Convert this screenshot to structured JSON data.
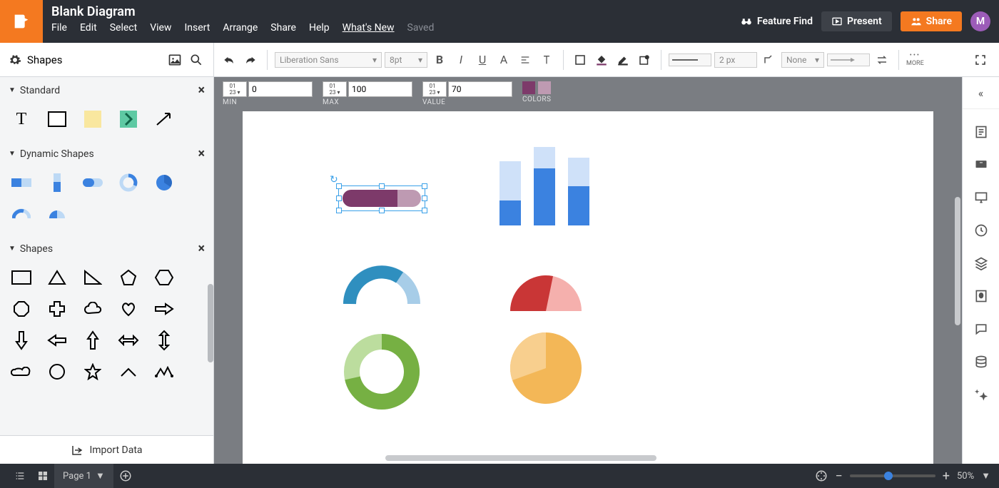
{
  "header": {
    "title": "Blank Diagram",
    "menu": [
      "File",
      "Edit",
      "Select",
      "View",
      "Insert",
      "Arrange",
      "Share",
      "Help"
    ],
    "whats_new": "What's New",
    "saved": "Saved",
    "feature_find": "Feature Find",
    "present": "Present",
    "share": "Share",
    "avatar_initial": "M"
  },
  "shapes_header": {
    "label": "Shapes"
  },
  "toolbar": {
    "font": "Liberation Sans",
    "font_size": "8pt",
    "stroke_width": "2 px",
    "line_type": "None",
    "more": "MORE"
  },
  "options": {
    "min_label": "MIN",
    "min_value": "0",
    "max_label": "MAX",
    "max_value": "100",
    "value_label": "VALUE",
    "value_value": "70",
    "colors_label": "COLORS",
    "color1": "#7d3a6a",
    "color2": "#be9ab2"
  },
  "panels": {
    "standard": "Standard",
    "dynamic": "Dynamic Shapes",
    "shapes": "Shapes"
  },
  "import": "Import Data",
  "bottom": {
    "page": "Page 1",
    "zoom": "50%"
  },
  "chart_data": {
    "selected_pill": {
      "type": "progress",
      "min": 0,
      "max": 100,
      "value": 70
    },
    "bars": {
      "type": "bar",
      "series": [
        {
          "total": 90,
          "value": 35
        },
        {
          "total": 110,
          "value": 80
        },
        {
          "total": 95,
          "value": 55
        }
      ]
    },
    "arc_blue": {
      "type": "arc",
      "percent": 65
    },
    "arc_red": {
      "type": "gauge",
      "percent": 40
    },
    "donut_green": {
      "type": "donut",
      "percent": 62
    },
    "pie_orange": {
      "type": "pie",
      "percent": 40
    }
  }
}
